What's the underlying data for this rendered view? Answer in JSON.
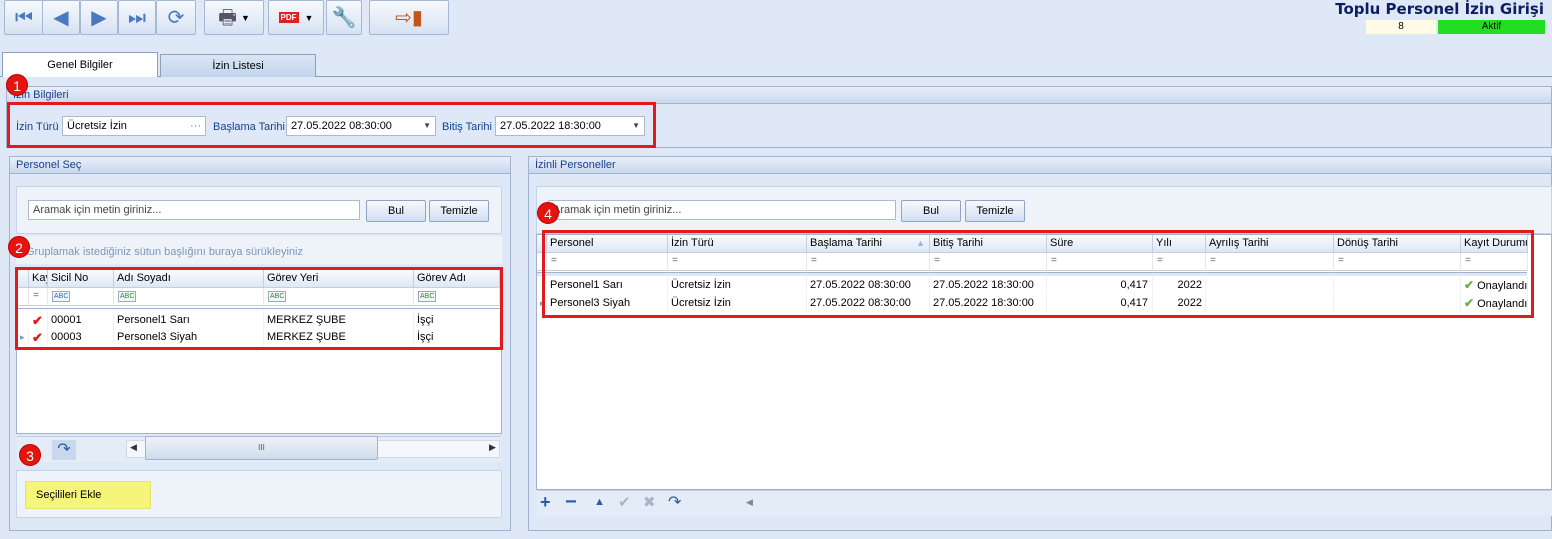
{
  "toolbar": {
    "first": "first-record-icon",
    "prev": "previous-record-icon",
    "next": "next-record-icon",
    "last": "last-record-icon",
    "refresh": "refresh-icon",
    "print": "printer-icon",
    "pdf": "pdf-save-icon",
    "settings": "document-settings-icon",
    "exit": "exit-door-icon"
  },
  "header": {
    "title": "Toplu Personel İzin Girişi",
    "count": "8",
    "status": "Aktif",
    "status_color": "#22dd22"
  },
  "tabs": [
    {
      "label": "Genel Bilgiler",
      "active": true
    },
    {
      "label": "İzin Listesi",
      "active": false
    }
  ],
  "izin_bilgileri": {
    "title": "İzin Bilgileri",
    "izin_turu_label": "İzin Türü",
    "izin_turu_value": "Ücretsiz İzin",
    "baslama_label": "Başlama Tarihi",
    "baslama_value": "27.05.2022 08:30:00",
    "bitis_label": "Bitiş Tarihi",
    "bitis_value": "27.05.2022 18:30:00"
  },
  "personel_sec": {
    "title": "Personel Seç",
    "search_placeholder": "Aramak için metin giriniz...",
    "find_button": "Bul",
    "clear_button": "Temizle",
    "group_hint": "Gruplamak istediğiniz sütun başlığını buraya sürükleyiniz",
    "columns": [
      "Kay",
      "Sicil No",
      "Adı Soyadı",
      "Görev Yeri",
      "Görev Adı"
    ],
    "rows": [
      {
        "sicil": "00001",
        "ad": "Personel1 Sarı",
        "yer": "MERKEZ ŞUBE",
        "gorev": "İşçi"
      },
      {
        "sicil": "00003",
        "ad": "Personel3 Siyah",
        "yer": "MERKEZ ŞUBE",
        "gorev": "İşçi"
      }
    ],
    "scroll_thumb": "III",
    "add_button": "Seçilileri Ekle"
  },
  "izinli_personeller": {
    "title": "İzinli Personeller",
    "search_placeholder": "Aramak için metin giriniz...",
    "find_button": "Bul",
    "clear_button": "Temizle",
    "columns": [
      "Personel",
      "İzin Türü",
      "Başlama Tarihi",
      "Bitiş Tarihi",
      "Süre",
      "Yılı",
      "Ayrılış Tarihi",
      "Dönüş Tarihi",
      "Kayıt Durumu"
    ],
    "rows": [
      {
        "personel": "Personel1 Sarı",
        "tur": "Ücretsiz İzin",
        "baslama": "27.05.2022 08:30:00",
        "bitis": "27.05.2022 18:30:00",
        "sure": "0,417",
        "yil": "2022",
        "ayrilis": "",
        "donus": "",
        "durum": "Onaylandı"
      },
      {
        "personel": "Personel3 Siyah",
        "tur": "Ücretsiz İzin",
        "baslama": "27.05.2022 08:30:00",
        "bitis": "27.05.2022 18:30:00",
        "sure": "0,417",
        "yil": "2022",
        "ayrilis": "",
        "donus": "",
        "durum": "Onaylandı"
      }
    ]
  },
  "annotations": [
    "1",
    "2",
    "3",
    "4"
  ],
  "highlight_color": "#e01b1b"
}
